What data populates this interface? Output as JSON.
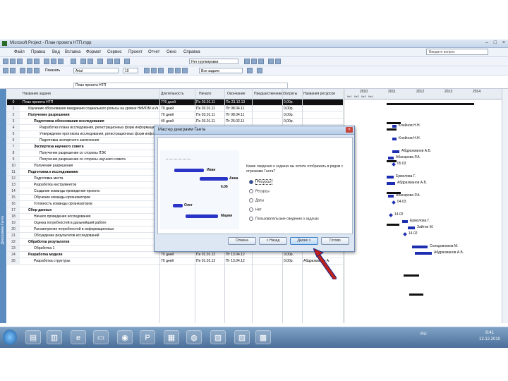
{
  "window": {
    "title": "Microsoft Project - План проекта НТП.mpp"
  },
  "menu": [
    "Файл",
    "Правка",
    "Вид",
    "Вставка",
    "Формат",
    "Сервис",
    "Проект",
    "Отчет",
    "Окно",
    "Справка"
  ],
  "help_box": "Введите вопрос",
  "toolbar": {
    "grouping": "Нет группировки",
    "task_filter": "Показать",
    "font": "Arial",
    "font_size": "10",
    "filter": "Все задачи"
  },
  "formula_bar": {
    "value": "План проекта НТП"
  },
  "sidebar": {
    "view_label": "Диаграмма Ганта"
  },
  "columns": [
    "Название задачи",
    "Длительность",
    "Начало",
    "Окончание",
    "Предшественники",
    "Затраты",
    "Названия ресурсов"
  ],
  "rows": [
    {
      "id": "0",
      "name": "План проекта НТП",
      "dur": "776 дней",
      "start": "Пн 03.01.11",
      "end": "Пн 23.12.13",
      "pred": "",
      "cost": "0,00р.",
      "res": "",
      "level": 0,
      "top": true
    },
    {
      "id": "1",
      "name": "Изучение обоснования внедрения социального рольсы на уровне НИИОМ и Интернет-технологий",
      "dur": "70 дней",
      "start": "Пн 03.01.11",
      "end": "Пт 08.04.11",
      "pred": "",
      "cost": "0,00р.",
      "res": "",
      "level": 1
    },
    {
      "id": "2",
      "name": "Получение разрешения",
      "dur": "70 дней",
      "start": "Пн 03.01.11",
      "end": "Пт 08.04.11",
      "pred": "",
      "cost": "0,00р.",
      "res": "",
      "level": 1,
      "sum": true
    },
    {
      "id": "3",
      "name": "Подготовка обоснования исследования",
      "dur": "40 дней",
      "start": "Пн 03.01.11",
      "end": "Пт 25.02.11",
      "pred": "",
      "cost": "0,00р.",
      "res": "",
      "level": 2,
      "sum": true
    },
    {
      "id": "4",
      "name": "Разработка плана исследования, регистрационных форм информационного",
      "dur": "",
      "start": "",
      "end": "",
      "pred": "",
      "cost": "",
      "res": "",
      "level": 3
    },
    {
      "id": "5",
      "name": "Утверждение протокола исследования, регистрационных форм информационного",
      "dur": "",
      "start": "",
      "end": "",
      "pred": "",
      "cost": "",
      "res": "",
      "level": 3
    },
    {
      "id": "6",
      "name": "Подготовка экспертного заключения",
      "dur": "",
      "start": "",
      "end": "",
      "pred": "",
      "cost": "",
      "res": "",
      "level": 3
    },
    {
      "id": "7",
      "name": "Экспертиза научного совета",
      "dur": "",
      "start": "",
      "end": "",
      "pred": "",
      "cost": "",
      "res": "",
      "level": 2,
      "sum": true
    },
    {
      "id": "8",
      "name": "Получение разрешения со стороны ЛЭК",
      "dur": "",
      "start": "",
      "end": "",
      "pred": "",
      "cost": "",
      "res": "",
      "level": 3
    },
    {
      "id": "9",
      "name": "Получение разрешения со стороны научного совета",
      "dur": "",
      "start": "",
      "end": "",
      "pred": "",
      "cost": "",
      "res": "",
      "level": 3
    },
    {
      "id": "10",
      "name": "Получение разрешения",
      "dur": "",
      "start": "",
      "end": "",
      "pred": "",
      "cost": "",
      "res": "",
      "level": 2
    },
    {
      "id": "11",
      "name": "Подготовка к исследованию",
      "dur": "",
      "start": "",
      "end": "",
      "pred": "",
      "cost": "",
      "res": "",
      "level": 1,
      "sum": true
    },
    {
      "id": "12",
      "name": "Подготовка места",
      "dur": "",
      "start": "",
      "end": "",
      "pred": "",
      "cost": "",
      "res": "",
      "level": 2
    },
    {
      "id": "13",
      "name": "Разработка инструментов",
      "dur": "",
      "start": "",
      "end": "",
      "pred": "",
      "cost": "",
      "res": "",
      "level": 2
    },
    {
      "id": "14",
      "name": "Создание команды проведения проекта",
      "dur": "",
      "start": "",
      "end": "",
      "pred": "",
      "cost": "",
      "res": "",
      "level": 2
    },
    {
      "id": "15",
      "name": "Обучение команды организаторов",
      "dur": "",
      "start": "",
      "end": "",
      "pred": "",
      "cost": "",
      "res": "",
      "level": 2
    },
    {
      "id": "16",
      "name": "Готовность команды организаторов",
      "dur": "",
      "start": "",
      "end": "",
      "pred": "",
      "cost": "",
      "res": "",
      "level": 2
    },
    {
      "id": "17",
      "name": "Сбор данных",
      "dur": "",
      "start": "",
      "end": "",
      "pred": "",
      "cost": "",
      "res": "",
      "level": 1,
      "sum": true
    },
    {
      "id": "18",
      "name": "Начало проведения исследования",
      "dur": "",
      "start": "",
      "end": "",
      "pred": "",
      "cost": "",
      "res": "",
      "level": 2
    },
    {
      "id": "19",
      "name": "Оценка потребностей в дальнейшей работе",
      "dur": "90 дней",
      "start": "Пт 21.01.11",
      "end": "Пт 27.07.11",
      "pred": "",
      "cost": "0,00р.",
      "res": "Ермолова Г.",
      "level": 2
    },
    {
      "id": "20",
      "name": "Рассмотрение потребностей в информационных",
      "dur": "90 дней",
      "start": "Пт 21.01.11",
      "end": "Пт 11.10.11",
      "pred": "",
      "cost": "0,00р.",
      "res": "Зайцев М.",
      "level": 2
    },
    {
      "id": "21",
      "name": "Обсуждение результатов исследований",
      "dur": "90 дней",
      "start": "Пт 21.01.11",
      "end": "Пт 11.10.11",
      "pred": "",
      "cost": "0,00р.",
      "res": "",
      "level": 2
    },
    {
      "id": "22",
      "name": "Обработка результатов",
      "dur": "100 дней",
      "start": "Пн 02.05.11",
      "end": "Пт 08.11.11",
      "pred": "",
      "cost": "0,00р.",
      "res": "",
      "level": 1,
      "sum": true
    },
    {
      "id": "23",
      "name": "Обработка 1",
      "dur": "70 дней",
      "start": "Пн 02.05.11",
      "end": "Пт 08.11.11",
      "pred": "",
      "cost": "0,00р.",
      "res": "Солодовников М.",
      "level": 2
    },
    {
      "id": "24",
      "name": "Разработка модели",
      "dur": "70 дней",
      "start": "Пн 01.01.12",
      "end": "Пт 13.04.12",
      "pred": "",
      "cost": "0,00р.",
      "res": "",
      "level": 1,
      "sum": true
    },
    {
      "id": "25",
      "name": "Разработка структуры",
      "dur": "70 дней",
      "start": "Пн 01.01.12",
      "end": "Пт 13.04.12",
      "pred": "",
      "cost": "0,00р.",
      "res": "Абдрахманов А.",
      "level": 2
    }
  ],
  "gantt": {
    "years": [
      "2010",
      "2011",
      "2012",
      "2013",
      "2014"
    ],
    "quarters": [
      "Кв1",
      "Кв2",
      "Кв3",
      "Кв4"
    ],
    "bars": [
      {
        "label": "Клейнов Н.Н.",
        "row": 4
      },
      {
        "label": "Клейнов Н.Н.",
        "row": 6
      },
      {
        "label": "Абдрахманов А.Б.",
        "row": 8
      },
      {
        "label": "Абасарова Р.А.",
        "row": 9
      },
      {
        "label": "05.03",
        "row": 10
      },
      {
        "label": "Ермолова Г.",
        "row": 12
      },
      {
        "label": "Абдрахманов А.Б.",
        "row": 13
      },
      {
        "label": "Абасарова Р.А.",
        "row": 15
      },
      {
        "label": "04.03",
        "row": 16
      },
      {
        "label": "14.02",
        "row": 18
      },
      {
        "label": "Ермолова Г.",
        "row": 19
      },
      {
        "label": "Зайтин М.",
        "row": 20
      },
      {
        "label": "14.02",
        "row": 21
      },
      {
        "label": "Солодовников М.",
        "row": 23
      },
      {
        "label": "Абдрахманов А.Б.",
        "row": 24
      }
    ]
  },
  "dialog": {
    "title": "Мастер диаграмм Ганта",
    "prompt": "Какие сведения о задачах вы хотите отображать в рядом с отрезками Ганта?",
    "options": [
      "Ресурсы",
      "Ресурсы",
      "Даты",
      "Нет",
      "Пользовательские сведения о задачах"
    ],
    "selected_index": 0,
    "preview_labels": {
      "task1": "Иван",
      "task2": "Анна",
      "milestone": "6.06",
      "task3": "Олег",
      "task4": "Мария"
    },
    "buttons": {
      "cancel": "Отмена",
      "back": "< Назад",
      "next": "Далее >",
      "finish": "Готово"
    }
  },
  "taskbar": {
    "tray_lang": "RU",
    "time": "8:41",
    "date": "12.12.2010"
  },
  "colors": {
    "bar": "#1d2fb0",
    "summary": "#111111",
    "accent": "#5a8cc0",
    "arrow": "#c0201c"
  }
}
